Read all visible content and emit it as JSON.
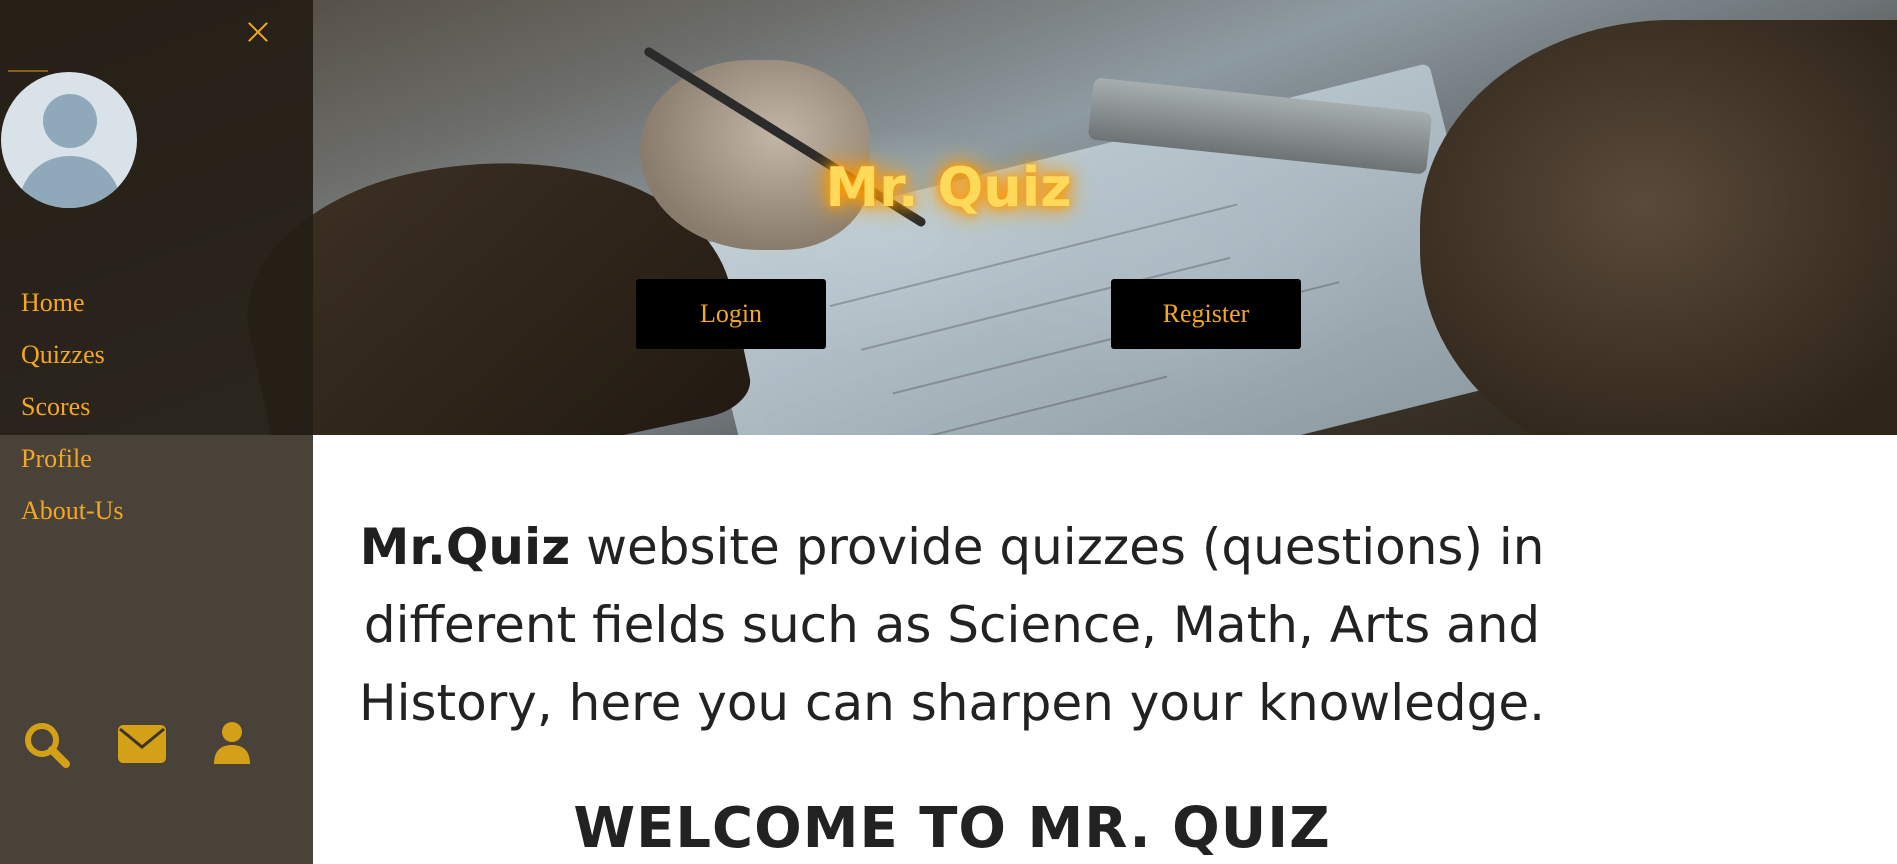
{
  "hero": {
    "title": "Mr. Quiz",
    "login_label": "Login",
    "register_label": "Register"
  },
  "sidebar": {
    "items": [
      {
        "label": "Home"
      },
      {
        "label": "Quizzes"
      },
      {
        "label": "Scores"
      },
      {
        "label": "Profile"
      },
      {
        "label": "About-Us"
      }
    ],
    "icons": [
      "search-icon",
      "envelope-icon",
      "user-icon"
    ]
  },
  "main": {
    "brand": "Mr.Quiz",
    "description": " website provide quizzes (questions) in different fields such as Science, Math, Arts and History, here you can sharpen your knowledge.",
    "welcome": "WELCOME TO MR. QUIZ"
  },
  "colors": {
    "accent": "#f5a623",
    "sidebar_bg": "#3d3428",
    "button_bg": "#000000",
    "title_glow": "#ffd95a"
  }
}
